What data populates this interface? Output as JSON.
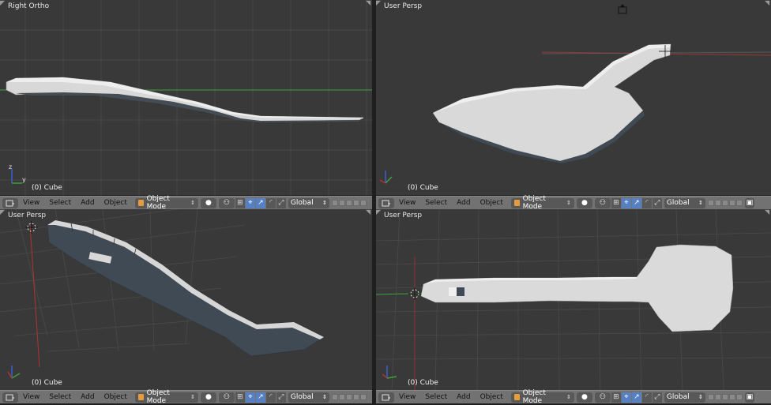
{
  "viewports": [
    {
      "title": "Right Ortho",
      "object": "(0) Cube"
    },
    {
      "title": "User Persp",
      "object": "(0) Cube"
    },
    {
      "title": "User Persp",
      "object": "(0) Cube"
    },
    {
      "title": "User Persp",
      "object": "(0) Cube"
    }
  ],
  "header": {
    "view": "View",
    "select": "Select",
    "add": "Add",
    "object": "Object",
    "mode": "Object Mode",
    "orientation": "Global"
  },
  "icons": [
    "editor-type-icon",
    "cube-icon",
    "shading-sphere-icon",
    "pivot-icon",
    "manipulator-icon",
    "translate-icon",
    "rotate-icon",
    "scale-icon",
    "layer-icon",
    "camera-icon"
  ],
  "colors": {
    "viewport_bg": "#393939",
    "header_bg": "#727272",
    "grid": "#4a4a4a",
    "mesh_light": "#d9d9d9",
    "mesh_dark": "#3e4a55",
    "axis_x": "#b33333",
    "axis_y": "#3ea03e",
    "active_tool": "#5680c2",
    "object_mode_icon": "#e69b3c"
  }
}
